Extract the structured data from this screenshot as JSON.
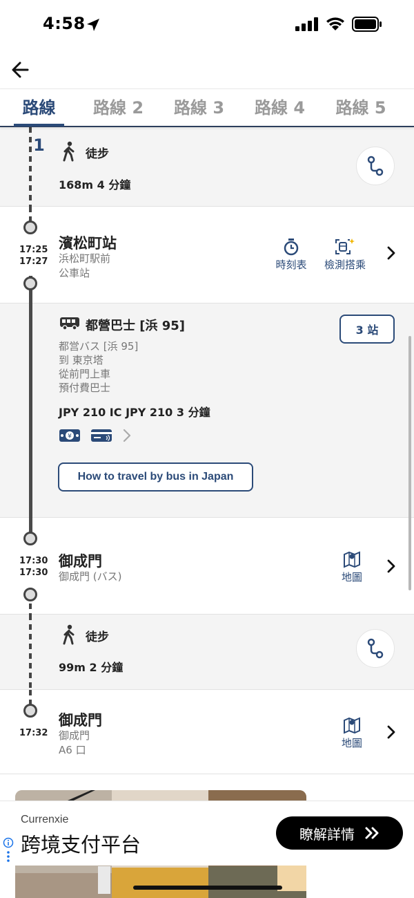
{
  "status_bar": {
    "time": "4:58"
  },
  "tabs": [
    {
      "label": "路線 1",
      "active": true
    },
    {
      "label": "路線 2",
      "active": false
    },
    {
      "label": "路線 3",
      "active": false
    },
    {
      "label": "路線 4",
      "active": false
    },
    {
      "label": "路線 5",
      "active": false
    }
  ],
  "walk1": {
    "label": "徒步",
    "detail": "168m 4 分鐘"
  },
  "station1": {
    "times": [
      "17:25",
      "17:27"
    ],
    "name": "濱松町站",
    "sub": [
      "浜松町駅前",
      "公車站"
    ],
    "actions": [
      "時刻表",
      "檢測搭乘"
    ]
  },
  "bus": {
    "title": "都營巴士 [浜 95]",
    "stops": "3 站",
    "sub": [
      "都営バス [浜 95]",
      "到 東京塔",
      "從前門上車",
      "預付費巴士"
    ],
    "fare": "JPY 210 IC JPY 210 3 分鐘",
    "howto": "How to travel by bus in Japan"
  },
  "station2": {
    "times": [
      "17:30",
      "17:30"
    ],
    "name": "御成門",
    "sub": [
      "御成門 (バス)"
    ],
    "action": "地圖"
  },
  "walk2": {
    "label": "徒步",
    "detail": "99m 2 分鐘"
  },
  "station3": {
    "time": "17:32",
    "name": "御成門",
    "sub": [
      "御成門",
      "A6 口"
    ],
    "action": "地圖"
  },
  "ad": {
    "brand": "Currenxie",
    "headline": "跨境支付平台",
    "cta": "瞭解詳情"
  },
  "colors": {
    "accent": "#2b4a78",
    "line": "#4a4a4a"
  }
}
